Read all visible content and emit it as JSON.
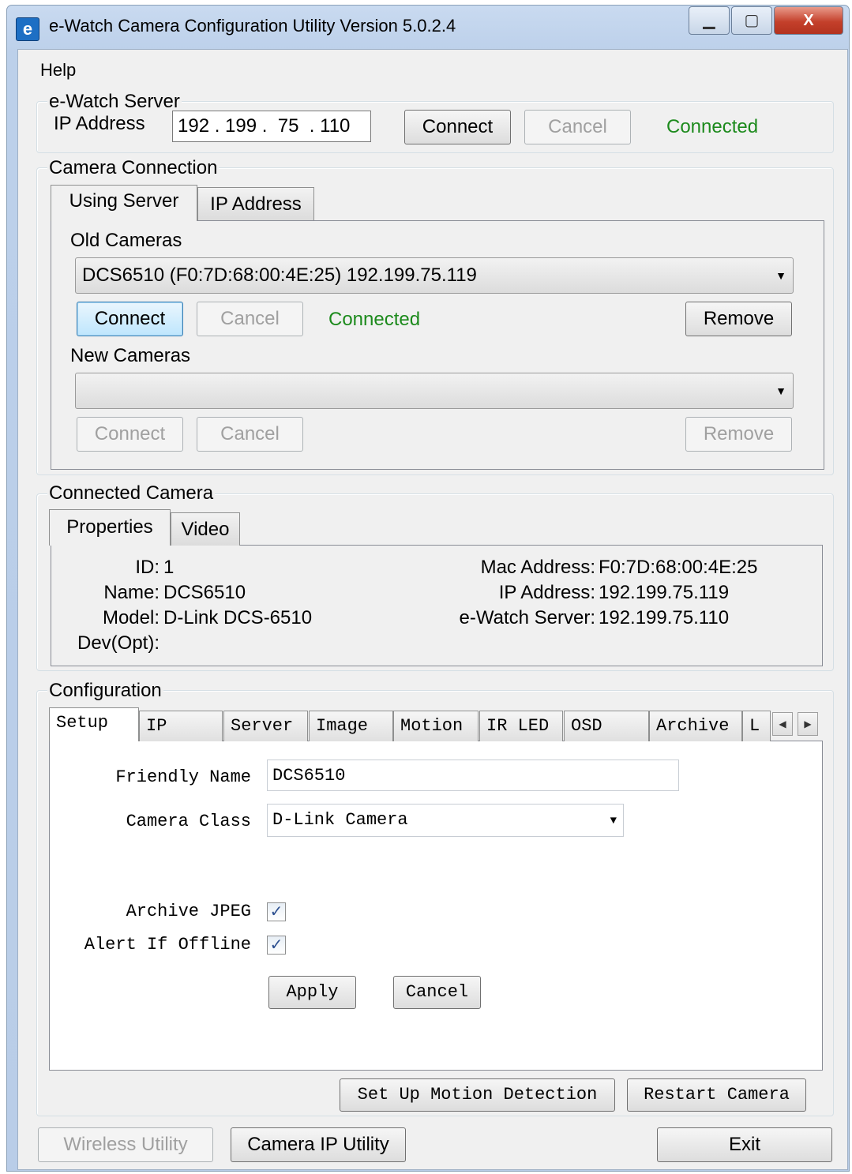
{
  "window": {
    "title": "e-Watch Camera Configuration Utility Version 5.0.2.4",
    "app_icon": "e-watch-logo-icon",
    "minimize_glyph": "▁",
    "maximize_glyph": "▢",
    "close_glyph": "X"
  },
  "menu": {
    "help": "Help"
  },
  "server_group": {
    "title": "e-Watch Server",
    "ip_label": "IP Address",
    "ip_value": "192 . 199 .  75  . 110",
    "connect": "Connect",
    "cancel": "Cancel",
    "status": "Connected"
  },
  "camera_connection": {
    "title": "Camera Connection",
    "tabs": [
      "Using Server",
      "IP Address"
    ],
    "old_cameras_label": "Old Cameras",
    "old_camera_selected": "DCS6510 (F0:7D:68:00:4E:25) 192.199.75.119",
    "old_connect": "Connect",
    "old_cancel": "Cancel",
    "old_status": "Connected",
    "old_remove": "Remove",
    "new_cameras_label": "New Cameras",
    "new_camera_selected": "",
    "new_connect": "Connect",
    "new_cancel": "Cancel",
    "new_remove": "Remove",
    "dropdown_arrow": "▼"
  },
  "connected_camera": {
    "title": "Connected Camera",
    "tabs": [
      "Properties",
      "Video"
    ],
    "id_label": "ID:",
    "id_value": "1",
    "name_label": "Name:",
    "name_value": "DCS6510",
    "model_label": "Model:",
    "model_value": "D-Link DCS-6510",
    "dev_label": "Dev(Opt):",
    "dev_value": "",
    "mac_label": "Mac Address:",
    "mac_value": "F0:7D:68:00:4E:25",
    "ip_label": "IP Address:",
    "ip_value": "192.199.75.119",
    "server_label": "e-Watch Server:",
    "server_value": "192.199.75.110"
  },
  "configuration": {
    "title": "Configuration",
    "tabs": [
      "Setup",
      "IP",
      "Server",
      "Image",
      "Motion",
      "IR LED",
      "OSD",
      "Archive",
      "L"
    ],
    "scroll_left": "◀",
    "scroll_right": "▶",
    "friendly_name_label": "Friendly Name",
    "friendly_name_value": "DCS6510",
    "camera_class_label": "Camera Class",
    "camera_class_value": "D-Link Camera",
    "archive_jpeg_label": "Archive JPEG",
    "archive_jpeg_checked": true,
    "alert_offline_label": "Alert If Offline",
    "alert_offline_checked": true,
    "check_glyph": "✓",
    "apply": "Apply",
    "cancel": "Cancel",
    "setup_motion": "Set Up Motion Detection",
    "restart_camera": "Restart Camera"
  },
  "footer": {
    "wireless_utility": "Wireless Utility",
    "camera_ip_utility": "Camera IP Utility",
    "exit": "Exit"
  }
}
